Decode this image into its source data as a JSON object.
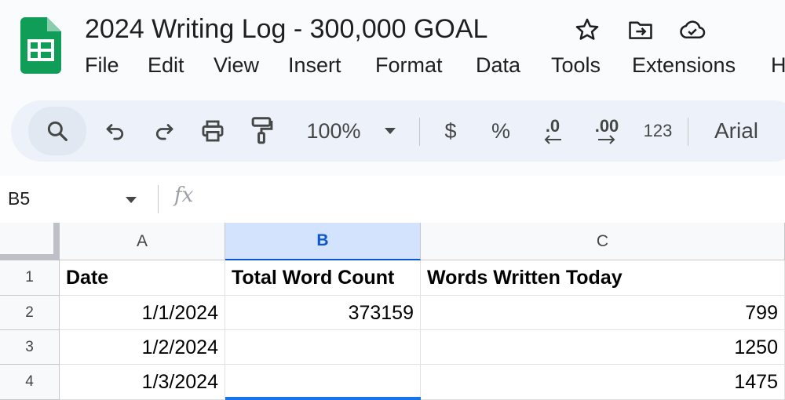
{
  "app": {
    "doc_title": "2024 Writing Log - 300,000 GOAL",
    "title_icons": [
      "star-icon",
      "move-to-folder-icon",
      "cloud-saved-icon"
    ]
  },
  "menu": [
    "File",
    "Edit",
    "View",
    "Insert",
    "Format",
    "Data",
    "Tools",
    "Extensions",
    "H"
  ],
  "toolbar": {
    "zoom": "100%",
    "currency": "$",
    "percent": "%",
    "decrease_decimal": ".0",
    "increase_decimal": ".00",
    "number_format": "123",
    "font": "Arial",
    "icons": [
      "search-icon",
      "undo-icon",
      "redo-icon",
      "print-icon",
      "paint-format-icon",
      "zoom-dropdown-icon"
    ]
  },
  "formula_bar": {
    "name_box": "B5",
    "fx": "fx",
    "formula": ""
  },
  "sheet": {
    "columns": [
      "A",
      "B",
      "C"
    ],
    "selected_column": "B",
    "rows": [
      {
        "num": "1",
        "cells": [
          "Date",
          "Total Word Count",
          "Words Written Today"
        ]
      },
      {
        "num": "2",
        "cells": [
          "1/1/2024",
          "373159",
          "799"
        ]
      },
      {
        "num": "3",
        "cells": [
          "1/2/2024",
          "",
          "1250"
        ]
      },
      {
        "num": "4",
        "cells": [
          "1/3/2024",
          "",
          "1475"
        ]
      }
    ]
  },
  "colors": {
    "logo_green": "#0f9d58",
    "selection_blue": "#1a73e8",
    "selected_header_bg": "#d3e3fd",
    "toolbar_bg": "#edf2fa"
  }
}
